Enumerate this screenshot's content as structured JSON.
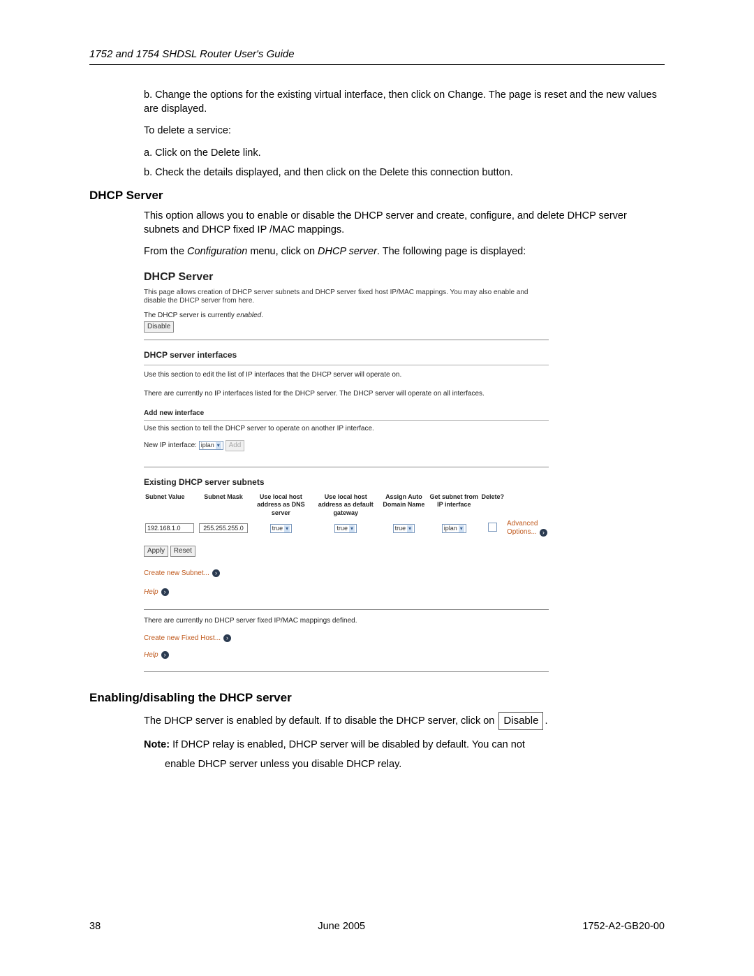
{
  "header": {
    "title": "1752 and 1754 SHDSL Router User's Guide"
  },
  "body": {
    "p1": "b. Change the options for the existing virtual interface, then click on Change. The page is reset and the new values are displayed.",
    "p2": "To delete a service:",
    "p3": "a. Click on the Delete link.",
    "p4": "b. Check the details displayed, and then click on the Delete this connection button.",
    "h1": "DHCP Server",
    "p5": "This option allows you to enable or disable the DHCP server and create, configure, and delete DHCP server subnets and DHCP fixed IP /MAC mappings.",
    "p6_pre": "From the ",
    "p6_i1": "Configuration",
    "p6_mid": " menu, click on ",
    "p6_i2": "DHCP server",
    "p6_post": ". The following page is displayed:"
  },
  "shot": {
    "title": "DHCP Server",
    "desc": "This page allows creation of DHCP server subnets and DHCP server fixed host IP/MAC mappings. You may also enable and disable the DHCP server from here.",
    "status_pre": "The DHCP server is currently ",
    "status_val": "enabled",
    "status_post": ".",
    "disable_btn": "Disable",
    "ifaces": {
      "title": "DHCP server interfaces",
      "desc": "Use this section to edit the list of IP interfaces that the DHCP server will operate on.",
      "none": "There are currently no IP interfaces listed for the DHCP server. The DHCP server will operate on all interfaces.",
      "add_title": "Add new interface",
      "add_desc": "Use this section to tell the DHCP server to operate on another IP interface.",
      "add_label": "New IP interface:",
      "add_sel": "iplan",
      "add_btn": "Add"
    },
    "subnets": {
      "title": "Existing DHCP server subnets",
      "headers": {
        "c1": "Subnet Value",
        "c2": "Subnet Mask",
        "c3": "Use local host address as DNS server",
        "c4": "Use local host address as default gateway",
        "c5": "Assign Auto Domain Name",
        "c6": "Get subnet from IP interface",
        "c7": "Delete?"
      },
      "row": {
        "value": "192.168.1.0",
        "mask": "255.255.255.0",
        "dns": "true",
        "gw": "true",
        "dom": "true",
        "iface": "iplan",
        "adv": "Advanced Options..."
      },
      "apply": "Apply",
      "reset": "Reset",
      "create": "Create new Subnet...",
      "help": "Help"
    },
    "fixed": {
      "none": "There are currently no DHCP server fixed IP/MAC mappings defined.",
      "create": "Create new Fixed Host...",
      "help": "Help"
    }
  },
  "followup": {
    "h2": "Enabling/disabling the DHCP server",
    "line1_pre": "The DHCP server is enabled by default. If to disable the DHCP server, click on ",
    "disable_btn": "Disable",
    "line1_post": ".",
    "line2_pre": "Note:",
    "line2_rest": " If DHCP relay is enabled, DHCP server will be disabled by default. You can not",
    "line3": "enable DHCP server unless you disable DHCP relay."
  },
  "footer": {
    "page": "38",
    "date": "June 2005",
    "doc": "1752-A2-GB20-00"
  }
}
